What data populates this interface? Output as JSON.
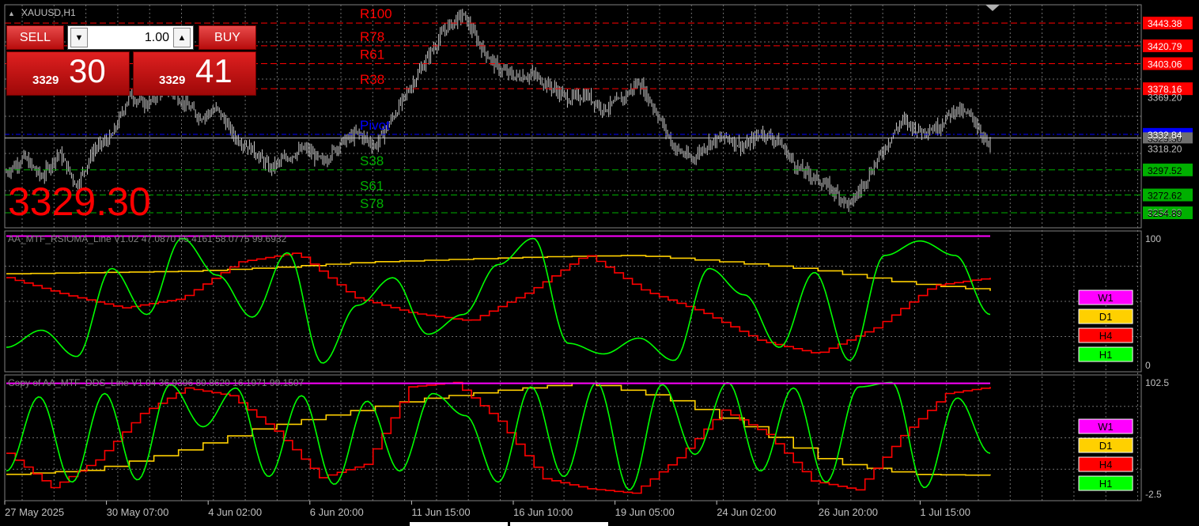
{
  "main_panel": {
    "symbol_title": "XAUUSD,H1",
    "big_price": "3329.30",
    "price_axis_labels": [
      "3369.20",
      "3329.30",
      "3318.20",
      "3254.89"
    ],
    "pivot_levels": [
      {
        "name": "R100",
        "price_tag": "3443.38",
        "kind": "resistance",
        "value": 3443.38
      },
      {
        "name": "R78",
        "price_tag": "3420.79",
        "kind": "resistance",
        "value": 3420.79
      },
      {
        "name": "R61",
        "price_tag": "3403.06",
        "kind": "resistance",
        "value": 3403.06
      },
      {
        "name": "R38",
        "price_tag": "3378.16",
        "kind": "resistance",
        "value": 3378.16
      },
      {
        "name": "Pivot",
        "price_tag": "3332.84",
        "kind": "pivot",
        "value": 3332.84
      },
      {
        "name": "S38",
        "price_tag": "3297.52",
        "kind": "support",
        "value": 3297.52
      },
      {
        "name": "S61",
        "price_tag": "3272.62",
        "kind": "support",
        "value": 3272.62
      },
      {
        "name": "S78",
        "price_tag": "3254.89",
        "kind": "support",
        "value": 3254.89
      }
    ]
  },
  "one_click": {
    "sell_label": "SELL",
    "buy_label": "BUY",
    "lots": "1.00",
    "sell_prefix": "3329",
    "sell_big": "30",
    "buy_prefix": "3329",
    "buy_big": "41"
  },
  "indicator1": {
    "title": "AA_MTF_RSIOMA_Line V1.02 47.0870 65.4161 58.0775 99.6932",
    "axis_top": "100",
    "axis_bottom": "0",
    "legend": [
      "W1",
      "D1",
      "H4",
      "H1"
    ]
  },
  "indicator2": {
    "title": "Copy of AA_MTF_DDS_Line V1.04 36.9396 89.8620 16.1971 99.1507",
    "axis_top": "102.5",
    "axis_bottom": "-2.5",
    "legend": [
      "W1",
      "D1",
      "H4",
      "H1"
    ]
  },
  "time_axis": [
    "27 May 2025",
    "30 May 07:00",
    "4 Jun 02:00",
    "6 Jun 20:00",
    "11 Jun 15:00",
    "16 Jun 10:00",
    "19 Jun 05:00",
    "24 Jun 02:00",
    "26 Jun 20:00",
    "1 Jul 15:00"
  ],
  "colors": {
    "background": "#000000",
    "grid": "#6e6e6e",
    "candles": "#c8c8c8",
    "resistance": "#ff0000",
    "support": "#00b000",
    "pivot": "#0000ff",
    "w1": "#ff00ff",
    "d1": "#ffd000",
    "h4": "#ff0000",
    "h1": "#00ff00"
  },
  "chart_data": [
    {
      "type": "line",
      "title": "XAUUSD,H1",
      "ylim": [
        3240,
        3460
      ],
      "x": [
        "27 May 2025",
        "30 May 07:00",
        "4 Jun 02:00",
        "6 Jun 20:00",
        "11 Jun 15:00",
        "16 Jun 10:00",
        "19 Jun 05:00",
        "24 Jun 02:00",
        "26 Jun 20:00",
        "1 Jul 15:00"
      ],
      "series": [
        {
          "values": [
            3295,
            3310,
            3290,
            3315,
            3282,
            3318,
            3330,
            3372,
            3362,
            3380,
            3366,
            3350,
            3358,
            3330,
            3318,
            3299,
            3310,
            3319,
            3305,
            3324,
            3334,
            3321,
            3350,
            3380,
            3410,
            3438,
            3452,
            3420,
            3398,
            3390,
            3392,
            3380,
            3368,
            3372,
            3358,
            3367,
            3385,
            3355,
            3320,
            3308,
            3325,
            3330,
            3320,
            3335,
            3325,
            3300,
            3290,
            3278,
            3262,
            3290,
            3320,
            3347,
            3336,
            3340,
            3358,
            3350,
            3318
          ]
        }
      ]
    },
    {
      "type": "line",
      "title": "AA_MTF_RSIOMA_Line V1.02",
      "ylim": [
        0,
        100
      ],
      "x": [
        "27 May 2025",
        "30 May 07:00",
        "4 Jun 02:00",
        "6 Jun 20:00",
        "11 Jun 15:00",
        "16 Jun 10:00",
        "19 Jun 05:00",
        "24 Jun 02:00",
        "26 Jun 20:00",
        "1 Jul 15:00"
      ],
      "series": [
        {
          "name": "W1",
          "values": [
            99.7,
            99.7,
            99.7,
            99.7,
            99.7,
            99.7,
            99.7,
            99.7,
            99.7,
            99.7,
            99.7
          ]
        },
        {
          "name": "D1",
          "values": [
            71,
            72,
            73,
            76,
            80,
            82,
            84,
            85,
            80,
            74,
            64,
            58
          ]
        },
        {
          "name": "H4",
          "values": [
            68,
            55,
            45,
            52,
            80,
            87,
            53,
            41,
            35,
            57,
            86,
            58,
            42,
            20,
            10,
            30,
            62,
            68
          ]
        },
        {
          "name": "H1",
          "values": [
            15,
            28,
            8,
            75,
            40,
            98,
            70,
            38,
            87,
            3,
            47,
            68,
            25,
            40,
            78,
            98,
            18,
            10,
            22,
            5,
            75,
            55,
            15,
            72,
            5,
            85,
            96,
            85,
            40
          ]
        }
      ]
    },
    {
      "type": "line",
      "title": "Copy of AA_MTF_DDS_Line V1.04",
      "ylim": [
        -2.5,
        102.5
      ],
      "x": [
        "27 May 2025",
        "30 May 07:00",
        "4 Jun 02:00",
        "6 Jun 20:00",
        "11 Jun 15:00",
        "16 Jun 10:00",
        "19 Jun 05:00",
        "24 Jun 02:00",
        "26 Jun 20:00",
        "1 Jul 15:00"
      ],
      "series": [
        {
          "name": "W1",
          "values": [
            99.2,
            99.2,
            99.2,
            99.2,
            99.2,
            99.2,
            99.2,
            99.2,
            99.2,
            99.2,
            99.2
          ]
        },
        {
          "name": "D1",
          "values": [
            17,
            21,
            37,
            58,
            72,
            85,
            93,
            100,
            86,
            60,
            28,
            17,
            16
          ]
        },
        {
          "name": "H4",
          "values": [
            36,
            5,
            30,
            72,
            95,
            88,
            56,
            14,
            26,
            96,
            100,
            65,
            13,
            4,
            0,
            32,
            75,
            53,
            11,
            3,
            52,
            90,
            96
          ]
        },
        {
          "name": "H1",
          "values": [
            20,
            87,
            10,
            90,
            12,
            98,
            60,
            95,
            15,
            88,
            8,
            83,
            20,
            90,
            70,
            10,
            96,
            15,
            100,
            3,
            98,
            35,
            100,
            20,
            95,
            10,
            96,
            100,
            5,
            86,
            36
          ]
        }
      ]
    }
  ]
}
